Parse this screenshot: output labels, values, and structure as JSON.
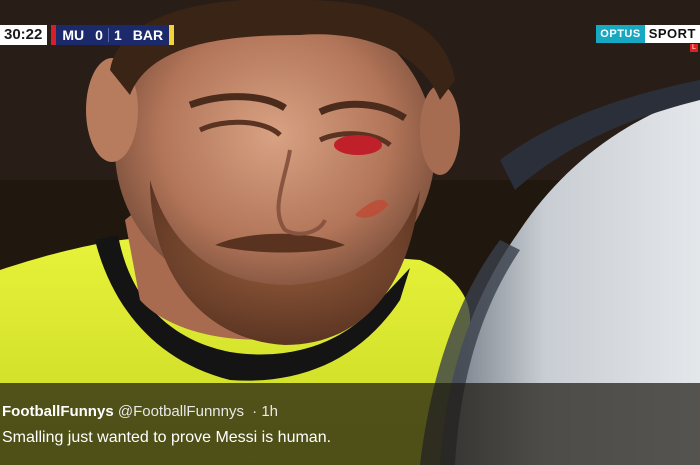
{
  "scoreboard": {
    "clock": "30:22",
    "home_team": "MU",
    "home_score": "0",
    "away_score": "1",
    "away_team": "BAR",
    "home_color": "#d4202a",
    "away_color": "#f2d43a"
  },
  "broadcaster": {
    "brand": "OPTUS",
    "channel": "SPORT",
    "live_marker": "L",
    "brand_color": "#17a9c2"
  },
  "tweet": {
    "display_name": "FootballFunnys",
    "handle": "@FootballFunnnys",
    "separator": "·",
    "time": "1h",
    "text": "Smalling just wanted to prove Messi is human."
  }
}
